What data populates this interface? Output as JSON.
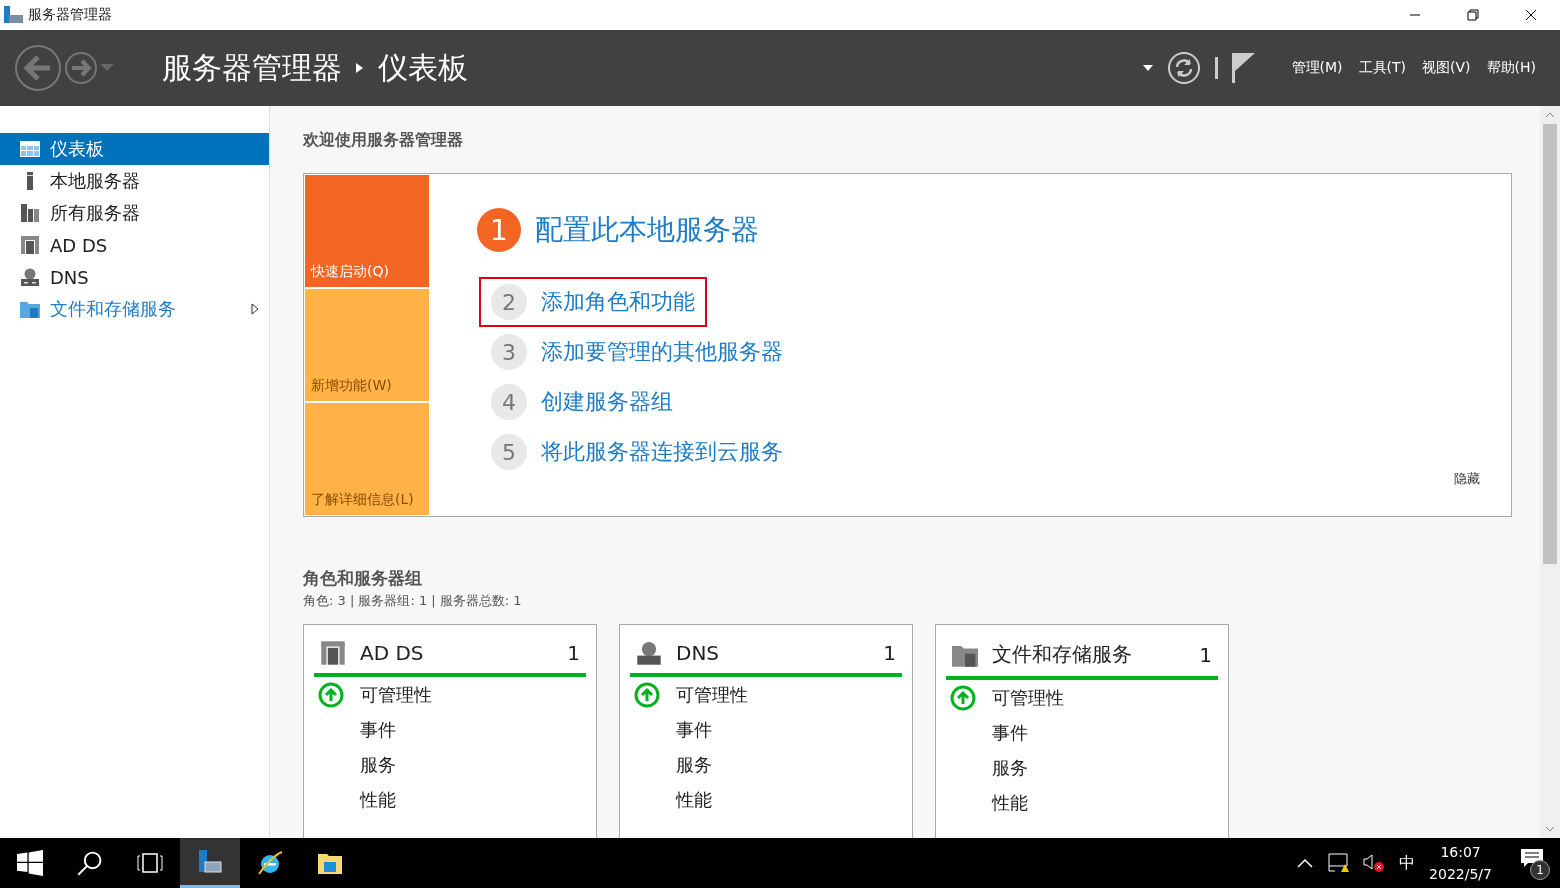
{
  "window": {
    "title": "服务器管理器"
  },
  "header": {
    "breadcrumb": [
      "服务器管理器",
      "仪表板"
    ],
    "menu": [
      "管理(M)",
      "工具(T)",
      "视图(V)",
      "帮助(H)"
    ]
  },
  "sidebar": {
    "items": [
      {
        "label": "仪表板",
        "selected": true,
        "expandable": false
      },
      {
        "label": "本地服务器",
        "selected": false,
        "expandable": false
      },
      {
        "label": "所有服务器",
        "selected": false,
        "expandable": false
      },
      {
        "label": "AD DS",
        "selected": false,
        "expandable": false
      },
      {
        "label": "DNS",
        "selected": false,
        "expandable": false
      },
      {
        "label": "文件和存储服务",
        "selected": false,
        "expandable": true
      }
    ]
  },
  "welcome": {
    "title": "欢迎使用服务器管理器",
    "tiles": [
      {
        "label": "快速启动(Q)",
        "selected": true
      },
      {
        "label": "新增功能(W)",
        "selected": false
      },
      {
        "label": "了解详细信息(L)",
        "selected": false
      }
    ],
    "steps": [
      {
        "number": "1",
        "label": "配置此本地服务器",
        "kind": "primary",
        "outlined": false
      },
      {
        "number": "2",
        "label": "添加角色和功能",
        "kind": "step",
        "outlined": true
      },
      {
        "number": "3",
        "label": "添加要管理的其他服务器",
        "kind": "step",
        "outlined": false
      },
      {
        "number": "4",
        "label": "创建服务器组",
        "kind": "step",
        "outlined": false
      },
      {
        "number": "5",
        "label": "将此服务器连接到云服务",
        "kind": "step",
        "outlined": false
      }
    ],
    "hide": "隐藏"
  },
  "roles": {
    "title": "角色和服务器组",
    "summary": "角色: 3 | 服务器组: 1 | 服务器总数: 1",
    "cards": [
      {
        "name": "AD DS",
        "count": "1",
        "rows": [
          {
            "label": "可管理性",
            "ok": true
          },
          {
            "label": "事件",
            "ok": false
          },
          {
            "label": "服务",
            "ok": false
          },
          {
            "label": "性能",
            "ok": false
          }
        ]
      },
      {
        "name": "DNS",
        "count": "1",
        "rows": [
          {
            "label": "可管理性",
            "ok": true
          },
          {
            "label": "事件",
            "ok": false
          },
          {
            "label": "服务",
            "ok": false
          },
          {
            "label": "性能",
            "ok": false
          }
        ]
      },
      {
        "name": "文件和存储服务",
        "count": "1",
        "rows": [
          {
            "label": "可管理性",
            "ok": true
          },
          {
            "label": "事件",
            "ok": false
          },
          {
            "label": "服务",
            "ok": false
          },
          {
            "label": "性能",
            "ok": false
          }
        ]
      }
    ]
  },
  "taskbar": {
    "apps": [
      {
        "selected": false
      },
      {
        "selected": false
      },
      {
        "selected": false
      },
      {
        "selected": true
      },
      {
        "selected": false
      },
      {
        "selected": false
      }
    ],
    "ime": "中",
    "time": "16:07",
    "date": "2022/5/7",
    "notifications": "1"
  }
}
